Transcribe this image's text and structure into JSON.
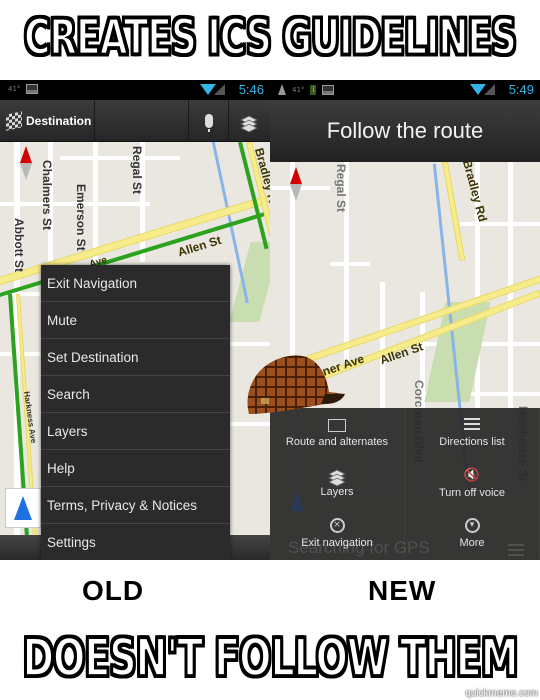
{
  "meme": {
    "top_caption": "CREATES ICS GUIDELINES",
    "bottom_caption": "DOESN'T FOLLOW THEM",
    "label_left": "OLD",
    "label_right": "NEW",
    "watermark": "quickmeme.com",
    "overlay_icon": "scumbag-hat-icon"
  },
  "old_screen": {
    "status_bar": {
      "time": "5:46",
      "temp": "41°"
    },
    "action_bar": {
      "destination_label": "Destination",
      "icons": [
        "checkered-flag-icon",
        "microphone-icon",
        "layers-icon"
      ]
    },
    "map_labels": [
      "Regal St",
      "Chalmers St",
      "Emerson St",
      "Abbott St",
      "Bradley Rd",
      "Allen St",
      "Ave",
      "Harkness Ave"
    ],
    "menu_items": [
      {
        "label": "Exit Navigation"
      },
      {
        "label": "Mute"
      },
      {
        "label": "Set Destination"
      },
      {
        "label": "Search"
      },
      {
        "label": "Layers"
      },
      {
        "label": "Help"
      },
      {
        "label": "Terms, Privacy & Notices"
      },
      {
        "label": "Settings"
      }
    ]
  },
  "new_screen": {
    "status_bar": {
      "time": "5:49",
      "temp": "41°"
    },
    "title": "Follow the route",
    "map_labels": [
      "Regal St",
      "Bradley Rd",
      "Sumner Ave",
      "Allen St",
      "Corcoran Blvd",
      "Newhouse St"
    ],
    "panel_items": [
      {
        "label": "Route and alternates",
        "icon": "route-map-icon"
      },
      {
        "label": "Directions list",
        "icon": "list-icon"
      },
      {
        "label": "Layers",
        "icon": "layers-icon"
      },
      {
        "label": "Turn off voice",
        "icon": "mute-speaker-icon"
      },
      {
        "label": "Exit navigation",
        "icon": "close-circle-icon"
      },
      {
        "label": "More",
        "icon": "chevron-down-circle-icon"
      }
    ],
    "background_status": "Searching for GPS"
  }
}
